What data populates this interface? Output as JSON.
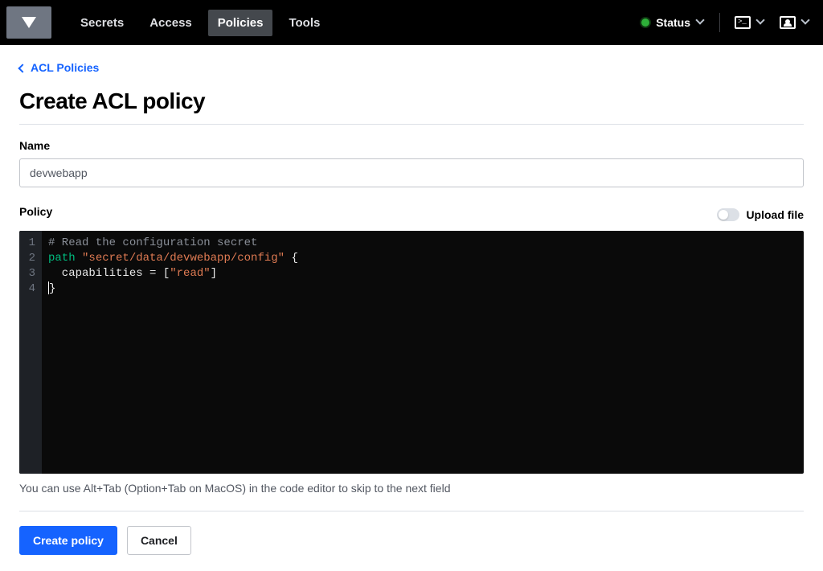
{
  "header": {
    "nav": {
      "secrets": "Secrets",
      "access": "Access",
      "policies": "Policies",
      "tools": "Tools"
    },
    "status_label": "Status"
  },
  "breadcrumb": {
    "label": "ACL Policies"
  },
  "page": {
    "title": "Create ACL policy"
  },
  "form": {
    "name_label": "Name",
    "name_value": "devwebapp",
    "policy_label": "Policy",
    "upload_label": "Upload file",
    "editor_hint": "You can use Alt+Tab (Option+Tab on MacOS) in the code editor to skip to the next field",
    "submit_label": "Create policy",
    "cancel_label": "Cancel"
  },
  "code": {
    "line1_comment": "# Read the configuration secret",
    "line2_keyword": "path",
    "line2_string": "\"secret/data/devwebapp/config\"",
    "line2_brace": " {",
    "line3_indent": "  capabilities = [",
    "line3_string": "\"read\"",
    "line3_close": "]",
    "line4": "}",
    "gutter1": "1",
    "gutter2": "2",
    "gutter3": "3",
    "gutter4": "4"
  }
}
